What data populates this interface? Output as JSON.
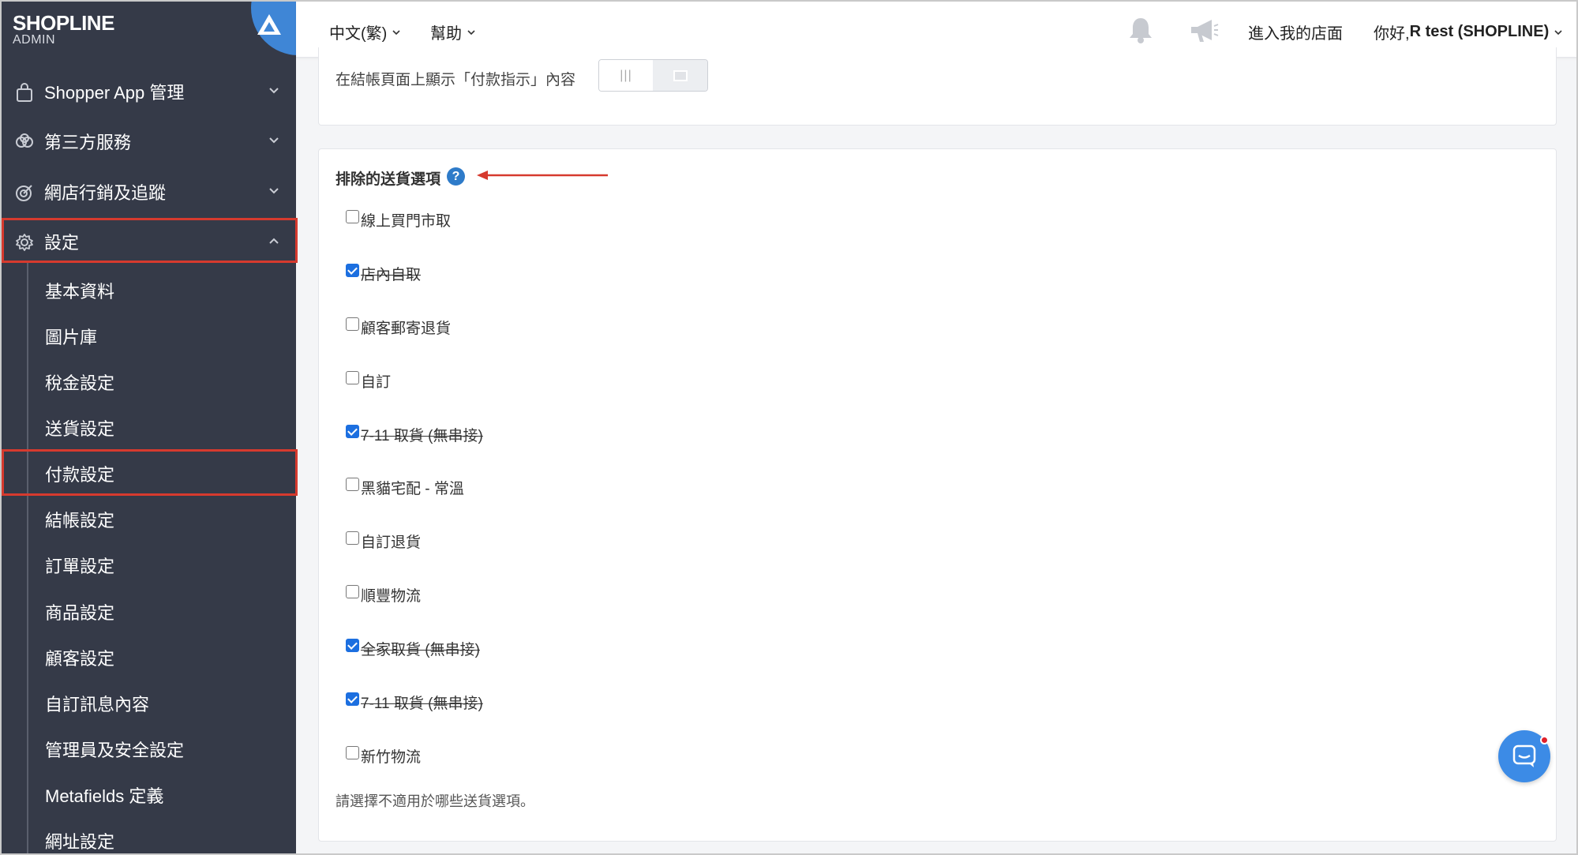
{
  "brand": {
    "name": "SHOPLINE",
    "sub": "ADMIN"
  },
  "sidebar": {
    "top_items": [
      {
        "label": "Shopper App 管理",
        "icon": "shopping-bag-icon"
      },
      {
        "label": "第三方服務",
        "icon": "integrations-icon"
      },
      {
        "label": "網店行銷及追蹤",
        "icon": "target-icon"
      },
      {
        "label": "設定",
        "icon": "gear-icon",
        "expanded": true
      }
    ],
    "settings_items": [
      "基本資料",
      "圖片庫",
      "稅金設定",
      "送貨設定",
      "付款設定",
      "結帳設定",
      "訂單設定",
      "商品設定",
      "顧客設定",
      "自訂訊息內容",
      "管理員及安全設定",
      "Metafields 定義",
      "網址設定"
    ]
  },
  "topbar": {
    "language": "中文(繁)",
    "help": "幫助",
    "visit_store": "進入我的店面",
    "greeting": "你好, ",
    "user": "R test (SHOPLINE)"
  },
  "payment_instruction": {
    "label": "在結帳頁面上顯示「付款指示」內容",
    "toggle_on": false
  },
  "excluded_delivery": {
    "title": "排除的送貨選項",
    "options": [
      {
        "label": "線上買門市取",
        "checked": false
      },
      {
        "label": "店內自取",
        "checked": true
      },
      {
        "label": "顧客郵寄退貨",
        "checked": false
      },
      {
        "label": "自訂",
        "checked": false
      },
      {
        "label": "7-11 取貨 (無串接)",
        "checked": true
      },
      {
        "label": "黑貓宅配 - 常溫",
        "checked": false
      },
      {
        "label": "自訂退貨",
        "checked": false
      },
      {
        "label": "順豐物流",
        "checked": false
      },
      {
        "label": "全家取貨 (無串接)",
        "checked": true
      },
      {
        "label": "7-11 取貨 (無串接)",
        "checked": true
      },
      {
        "label": "新竹物流",
        "checked": false
      }
    ],
    "hint": "請選擇不適用於哪些送貨選項。"
  },
  "colors": {
    "sidebar": "#353a48",
    "accent": "#3f86d6",
    "highlight": "#d63a2e"
  }
}
